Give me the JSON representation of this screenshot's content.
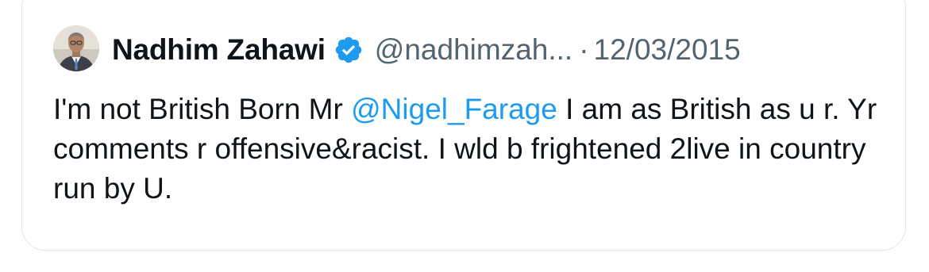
{
  "tweet": {
    "author_name": "Nadhim Zahawi",
    "handle": "@nadhimzah...",
    "separator": "·",
    "date": "12/03/2015",
    "verified_color": "#1d9bf0",
    "text_part1": "I'm not British Born Mr ",
    "mention": "@Nigel_Farage",
    "text_part2": " I am as British as u r. Yr comments r offensive&racist. I wld b frightened 2live in country run by U."
  }
}
